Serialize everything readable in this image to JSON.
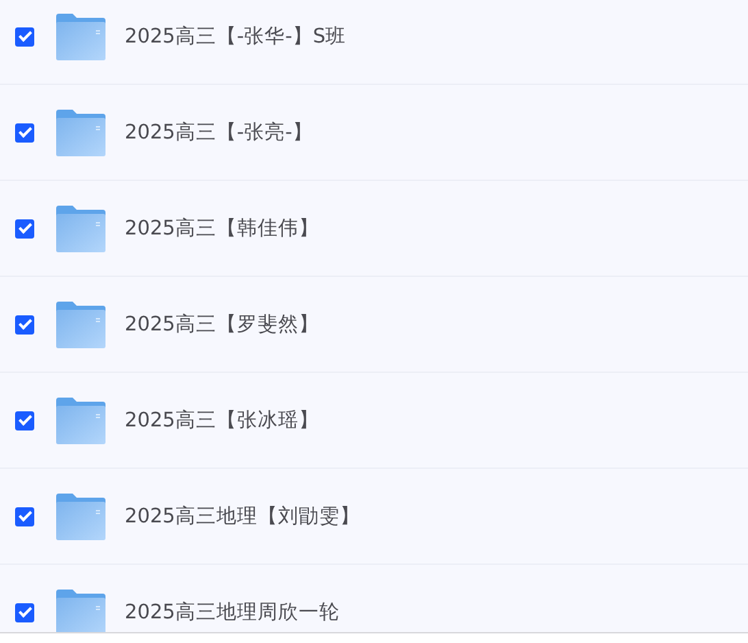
{
  "files": [
    {
      "name": "2025高三【-张华-】S班",
      "checked": true
    },
    {
      "name": "2025高三【-张亮-】",
      "checked": true
    },
    {
      "name": "2025高三【韩佳伟】",
      "checked": true
    },
    {
      "name": "2025高三【罗斐然】",
      "checked": true
    },
    {
      "name": "2025高三【张冰瑶】",
      "checked": true
    },
    {
      "name": "2025高三地理【刘勖雯】",
      "checked": true
    },
    {
      "name": "2025高三地理周欣一轮",
      "checked": true
    }
  ]
}
